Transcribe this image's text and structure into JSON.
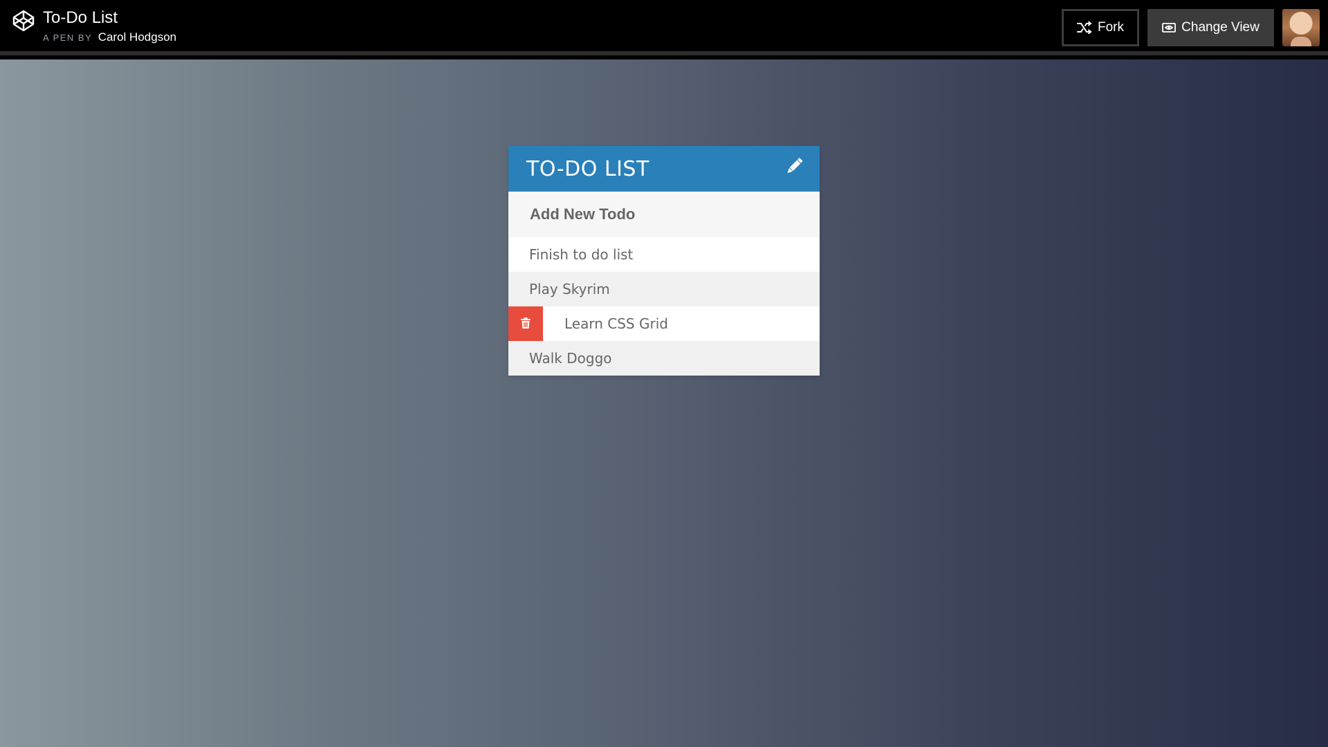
{
  "header": {
    "pen_title": "To-Do List",
    "by_prefix": "A PEN BY",
    "author": "Carol Hodgson",
    "fork_label": "Fork",
    "change_view_label": "Change View"
  },
  "todo_card": {
    "title": "TO-DO LIST",
    "input_placeholder": "Add New Todo",
    "items": [
      {
        "label": "Finish to do list"
      },
      {
        "label": "Play Skyrim"
      },
      {
        "label": "Learn CSS Grid"
      },
      {
        "label": "Walk Doggo"
      }
    ]
  },
  "icons": {
    "logo": "codepen-logo-icon",
    "fork": "fork-icon",
    "change_view": "eye-icon",
    "edit": "pencil-icon",
    "delete": "trash-icon"
  },
  "colors": {
    "header_accent": "#2a80b9",
    "delete": "#e74c3c",
    "topbar": "#000000"
  }
}
